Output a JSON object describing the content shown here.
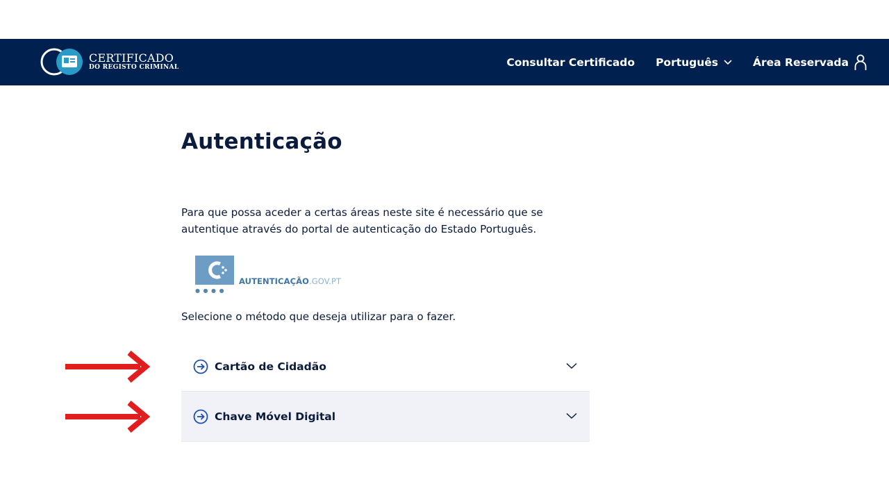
{
  "header": {
    "logo": {
      "line1": "CERTIFICADO",
      "line2": "DO REGISTO CRIMINAL"
    },
    "nav": {
      "consult": "Consultar Certificado",
      "language": "Português",
      "reserved": "Área Reservada"
    },
    "bg_color": "#00204f"
  },
  "main": {
    "title": "Autenticação",
    "intro": "Para que possa aceder a certas áreas neste site é necessário que se autentique através do portal de autenticação do Estado Português.",
    "auth_logo": {
      "brand": "AUTENTICAÇÃO",
      "suffix": ".GOV.PT"
    },
    "select_text": "Selecione o método que deseja utilizar para o fazer.",
    "methods": [
      {
        "label": "Cartão de Cidadão"
      },
      {
        "label": "Chave Móvel Digital"
      }
    ]
  },
  "annotations": {
    "arrow_color": "#e01e1e"
  }
}
